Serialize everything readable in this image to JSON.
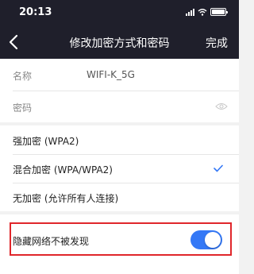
{
  "status": {
    "time": "20:13"
  },
  "nav": {
    "title": "修改加密方式和密码",
    "done": "完成"
  },
  "form": {
    "name_label": "名称",
    "name_value": "WIFI-K_5G",
    "password_label": "密码"
  },
  "encryption": {
    "options": [
      {
        "label": "强加密 (WPA2)",
        "selected": false
      },
      {
        "label": "混合加密 (WPA/WPA2)",
        "selected": true
      },
      {
        "label": "无加密 (允许所有人连接)",
        "selected": false
      }
    ]
  },
  "hidden": {
    "label": "隐藏网络不被发现",
    "enabled": true
  },
  "colors": {
    "bar": "#1f1f2b",
    "accent": "#3478f6",
    "highlight": "#e0262b"
  }
}
